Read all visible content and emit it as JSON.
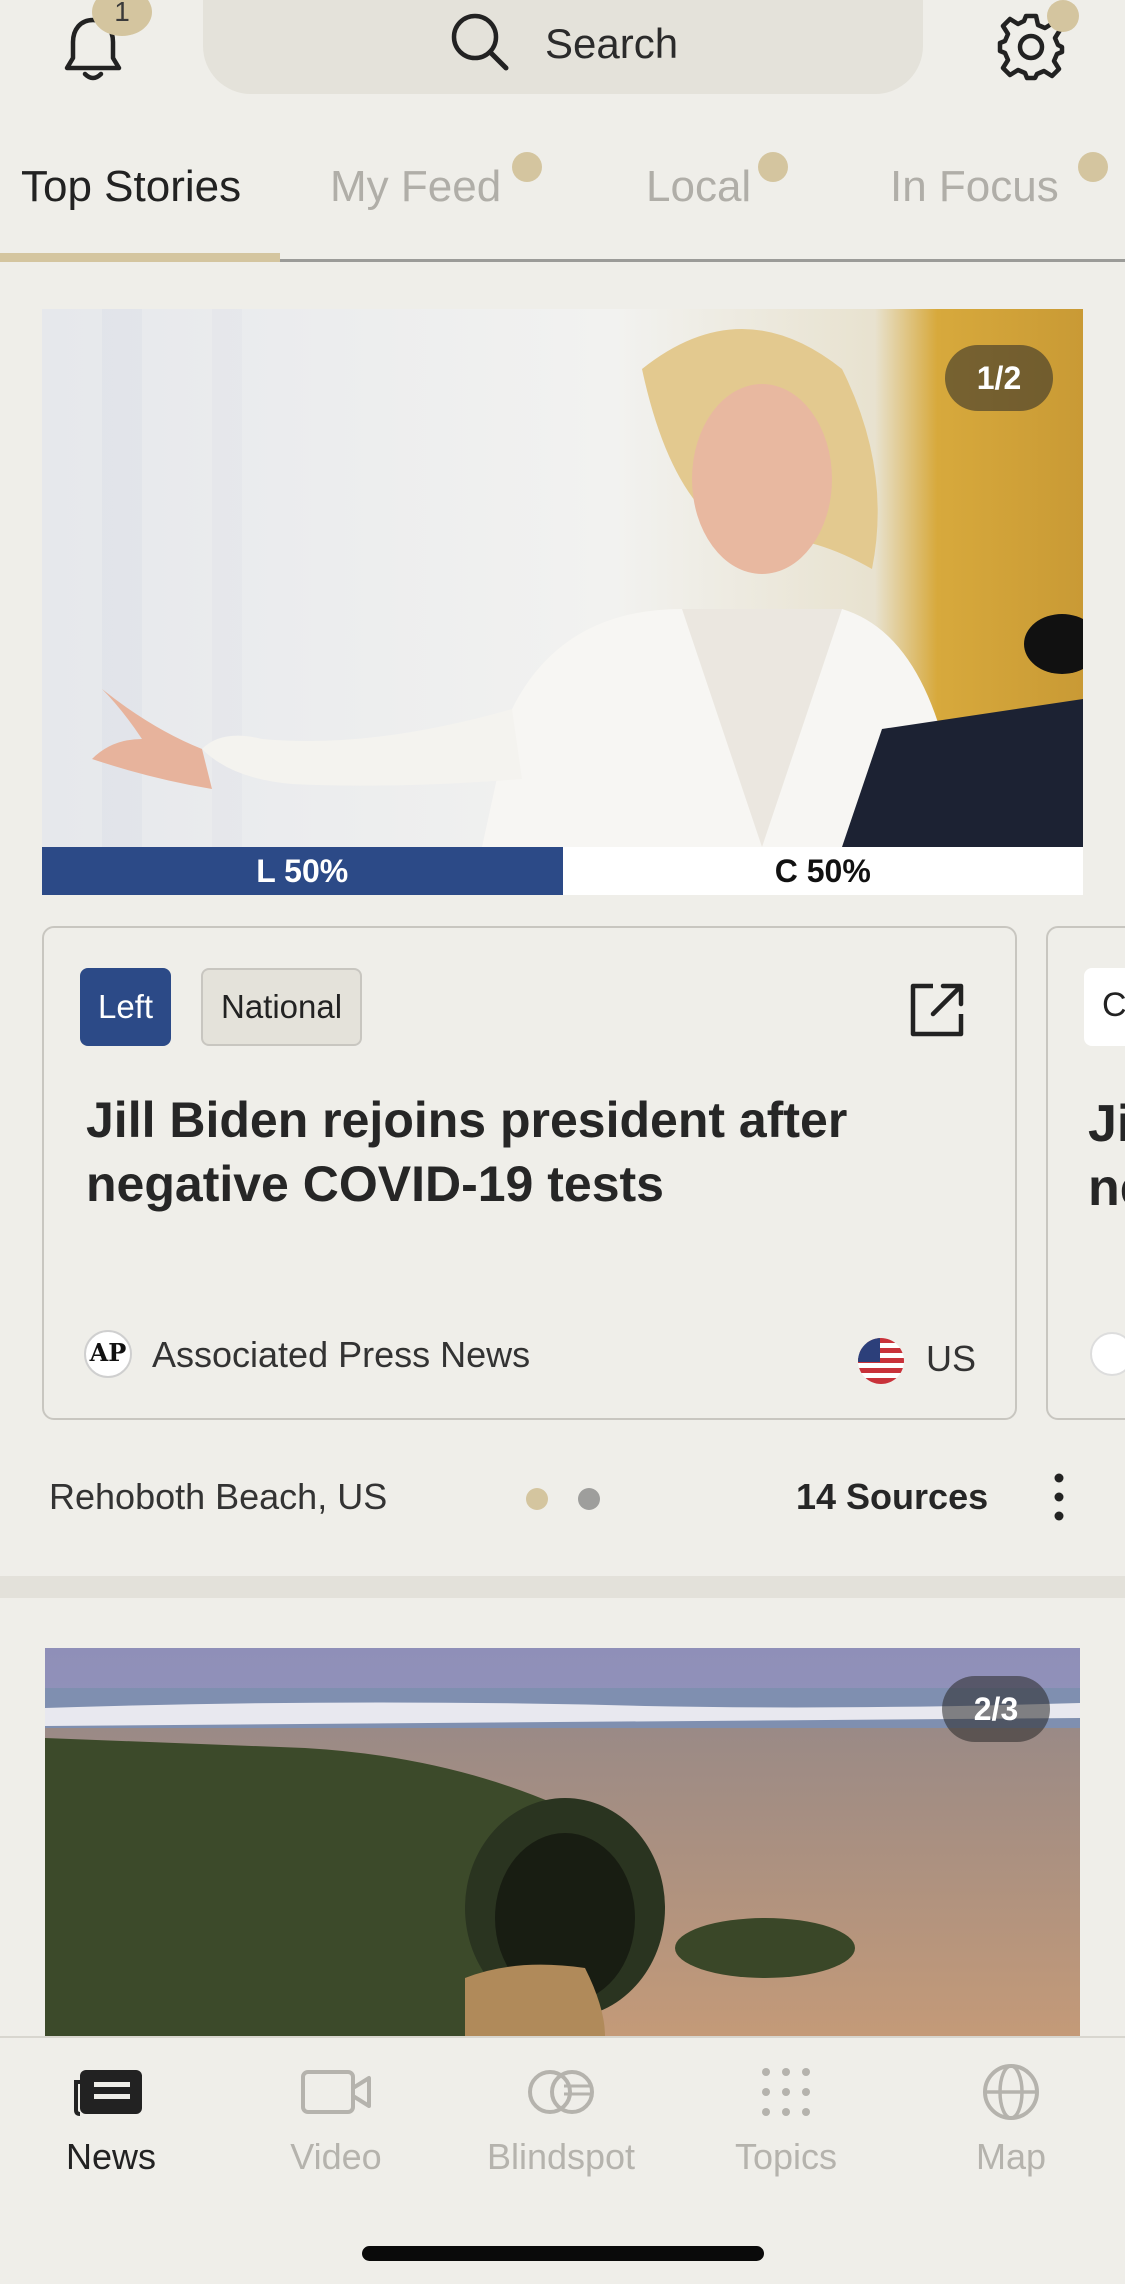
{
  "header": {
    "notification_count": "1",
    "search_placeholder": "Search"
  },
  "tabs": [
    {
      "label": "Top Stories",
      "active": true
    },
    {
      "label": "My Feed",
      "active": false
    },
    {
      "label": "Local",
      "active": false
    },
    {
      "label": "In Focus",
      "active": false
    }
  ],
  "stories": [
    {
      "image_counter": "1/2",
      "bias": {
        "left_label": "L 50%",
        "left_pct": 50,
        "center_label": "C 50%",
        "center_pct": 50
      },
      "article": {
        "bias_tag": "Left",
        "scope_tag": "National",
        "headline": "Jill Biden rejoins president after negative COVID-19 tests",
        "source_logo_text": "AP",
        "source_name": "Associated Press News",
        "country": "US"
      },
      "peek_card": {
        "chip_text": "C",
        "title_text": "Ji\nne"
      },
      "location": "Rehoboth Beach, US",
      "sources_count": "14 Sources"
    },
    {
      "image_counter": "2/3"
    }
  ],
  "bottom_nav": [
    {
      "label": "News",
      "icon": "news-icon",
      "active": true
    },
    {
      "label": "Video",
      "icon": "video-icon",
      "active": false
    },
    {
      "label": "Blindspot",
      "icon": "blindspot-icon",
      "active": false
    },
    {
      "label": "Topics",
      "icon": "topics-icon",
      "active": false
    },
    {
      "label": "Map",
      "icon": "globe-icon",
      "active": false
    }
  ],
  "colors": {
    "accent": "#d4c59f",
    "left_bias": "#2c4a87",
    "background": "#efeee9"
  }
}
